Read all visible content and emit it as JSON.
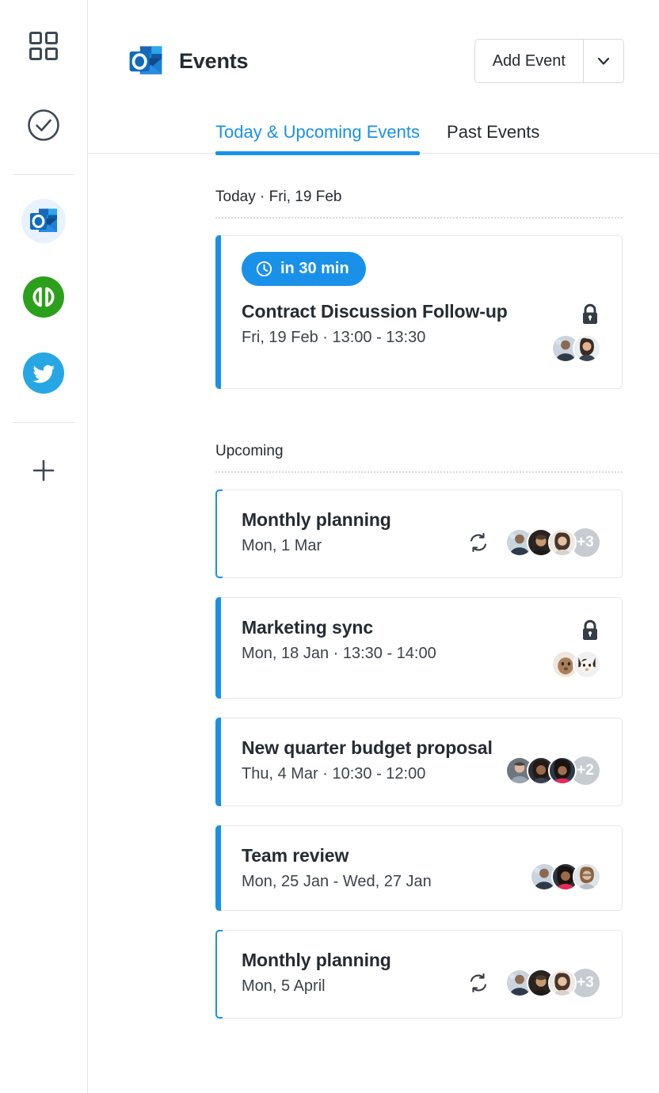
{
  "sidebar": {
    "items": [
      {
        "name": "apps-grid",
        "icon": "grid-icon",
        "label": "Apps",
        "active": false
      },
      {
        "name": "tasks",
        "icon": "check-circle-icon",
        "label": "Tasks",
        "active": false
      },
      {
        "name": "outlook",
        "icon": "outlook-icon",
        "label": "Outlook",
        "active": true
      },
      {
        "name": "quickbooks",
        "icon": "quickbooks-icon",
        "label": "QuickBooks",
        "active": false
      },
      {
        "name": "twitter",
        "icon": "twitter-icon",
        "label": "Twitter",
        "active": false
      },
      {
        "name": "add-integration",
        "icon": "plus-icon",
        "label": "Add",
        "active": false
      }
    ]
  },
  "header": {
    "app_icon": "outlook-icon",
    "title": "Events",
    "add_button_label": "Add Event",
    "add_button_caret_icon": "chevron-down-icon"
  },
  "tabs": [
    {
      "label": "Today & Upcoming Events",
      "active": true
    },
    {
      "label": "Past Events",
      "active": false
    }
  ],
  "sections": [
    {
      "heading": "Today · Fri, 19 Feb",
      "events": [
        {
          "badge": {
            "icon": "clock-icon",
            "label": "in 30 min"
          },
          "title": "Contract Discussion Follow-up",
          "subtitle": "Fri, 19 Feb · 13:00 - 13:30",
          "private_icon": "lock-icon",
          "recurring": false,
          "strip_style": "solid",
          "avatars": [
            "person-1",
            "person-2"
          ],
          "overflow_count": ""
        }
      ]
    },
    {
      "heading": "Upcoming",
      "events": [
        {
          "badge": null,
          "title": "Monthly planning",
          "subtitle": "Mon, 1 Mar",
          "private_icon": "",
          "recurring": true,
          "recurring_icon": "recurring-icon",
          "strip_style": "outline",
          "avatars": [
            "person-1",
            "person-3",
            "person-4"
          ],
          "overflow_count": "+3"
        },
        {
          "badge": null,
          "title": "Marketing sync",
          "subtitle": "Mon, 18 Jan · 13:30 - 14:00",
          "private_icon": "lock-icon",
          "recurring": false,
          "strip_style": "solid",
          "avatars": [
            "pet-cat",
            "pet-dog"
          ],
          "overflow_count": ""
        },
        {
          "badge": null,
          "title": "New quarter budget proposal",
          "subtitle": "Thu, 4 Mar · 10:30 - 12:00",
          "private_icon": "",
          "recurring": false,
          "strip_style": "solid",
          "avatars": [
            "person-5",
            "person-6",
            "person-7"
          ],
          "overflow_count": "+2"
        },
        {
          "badge": null,
          "title": "Team review",
          "subtitle": "Mon, 25 Jan - Wed, 27 Jan",
          "private_icon": "",
          "recurring": false,
          "strip_style": "solid",
          "avatars": [
            "person-1",
            "person-8",
            "person-9"
          ],
          "overflow_count": ""
        },
        {
          "badge": null,
          "title": "Monthly planning",
          "subtitle": "Mon, 5 April",
          "private_icon": "",
          "recurring": true,
          "recurring_icon": "recurring-icon",
          "strip_style": "outline",
          "avatars": [
            "person-1",
            "person-3",
            "person-4"
          ],
          "overflow_count": "+3"
        }
      ]
    }
  ],
  "colors": {
    "accent": "#1a91e8",
    "text": "#252b33",
    "subtext": "#3c434c",
    "border": "#e3e6e8",
    "overflow_badge": "#c7ccd2",
    "sidebar_active_bg": "#e8f2fc"
  }
}
